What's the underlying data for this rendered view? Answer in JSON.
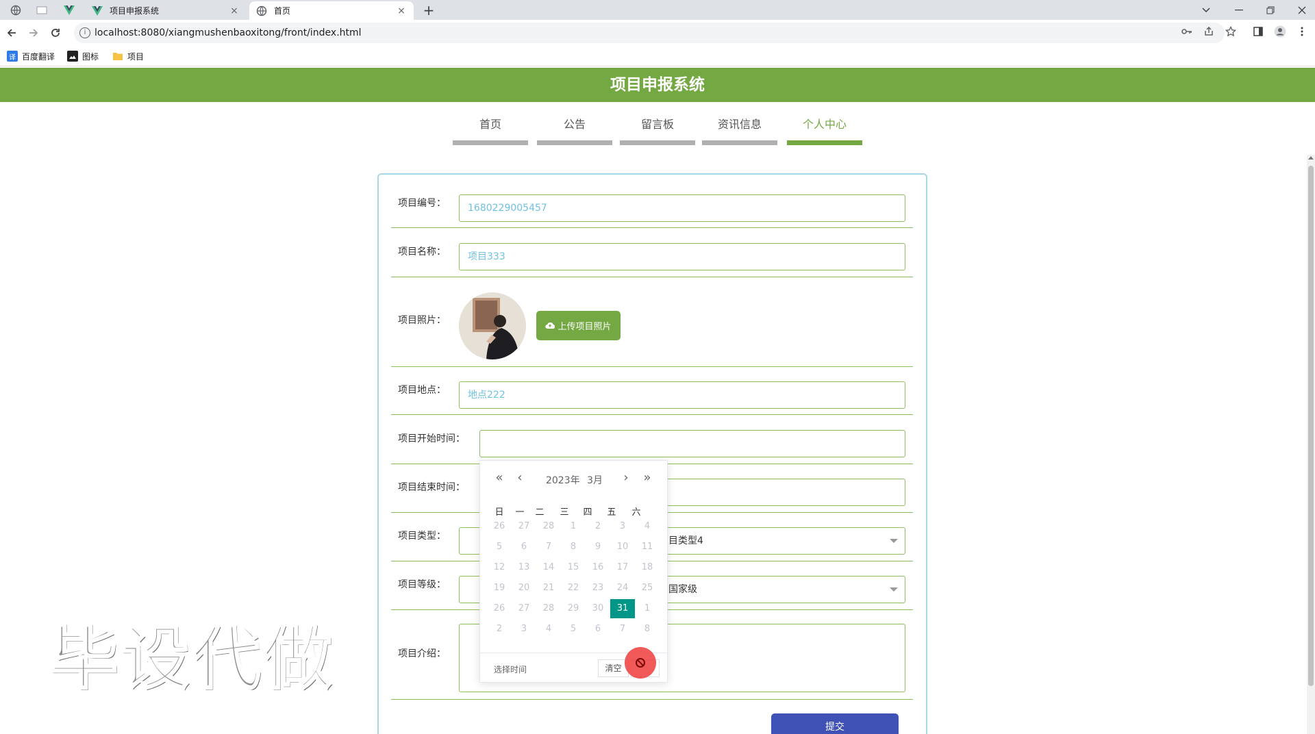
{
  "browser": {
    "tabs": [
      {
        "title": "项目申报系统",
        "close": "×"
      },
      {
        "title": "首页",
        "close": "×"
      }
    ],
    "new_tab": "+",
    "url": "localhost:8080/xiangmushenbaoxitong/front/index.html",
    "bookmarks": [
      "百度翻译",
      "图标",
      "项目"
    ],
    "colors": {
      "tab_strip": "#dee1e6",
      "vue_green": "#41b883"
    }
  },
  "page": {
    "site_title": "项目申报系统",
    "nav": [
      {
        "label": "首页",
        "active": false
      },
      {
        "label": "公告",
        "active": false
      },
      {
        "label": "留言板",
        "active": false
      },
      {
        "label": "资讯信息",
        "active": false
      },
      {
        "label": "个人中心",
        "active": true
      }
    ],
    "form": {
      "number_label": "项目编号：",
      "number_value": "1680229005457",
      "name_label": "项目名称：",
      "name_value": "项目333",
      "photo_label": "项目照片：",
      "upload_label": "上传项目照片",
      "location_label": "项目地点：",
      "location_value": "地点222",
      "start_label": "项目开始时间：",
      "start_value": "",
      "end_label": "项目结束时间：",
      "end_value": "",
      "type_label": "项目类型：",
      "type_value": "目类型4",
      "level_label": "项目等级：",
      "level_value": "国家级",
      "intro_label": "项目介绍：",
      "submit_label": "提交"
    },
    "colors": {
      "header_green": "#73a842",
      "accent_blue": "#3f51b5",
      "selected_teal": "#009688"
    }
  },
  "datepicker": {
    "year": "2023年",
    "month": "3月",
    "weekdays": [
      "日",
      "一",
      "二",
      "三",
      "四",
      "五",
      "六"
    ],
    "days": [
      [
        "26",
        "27",
        "28",
        "1",
        "2",
        "3",
        "4"
      ],
      [
        "5",
        "6",
        "7",
        "8",
        "9",
        "10",
        "11"
      ],
      [
        "12",
        "13",
        "14",
        "15",
        "16",
        "17",
        "18"
      ],
      [
        "19",
        "20",
        "21",
        "22",
        "23",
        "24",
        "25"
      ],
      [
        "26",
        "27",
        "28",
        "29",
        "30",
        "31",
        "1"
      ],
      [
        "2",
        "3",
        "4",
        "5",
        "6",
        "7",
        "8"
      ]
    ],
    "selected_day": "31",
    "select_time_label": "选择时间",
    "clear_label": "清空"
  },
  "watermark": "毕设代做"
}
